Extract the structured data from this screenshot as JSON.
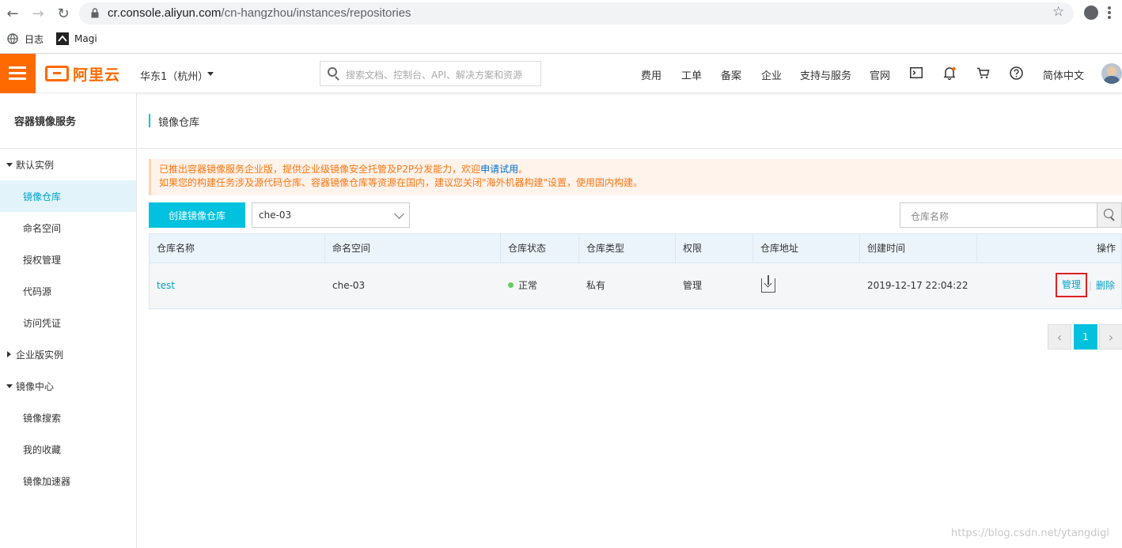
{
  "browser": {
    "url_host": "cr.console.aliyun.com",
    "url_path": "/cn-hangzhou/instances/repositories",
    "bookmarks": [
      {
        "label": "日志",
        "icon": "globe-icon"
      },
      {
        "label": "Magi",
        "icon": "magi-icon"
      }
    ]
  },
  "topbar": {
    "logo_text": "阿里云",
    "region": "华东1（杭州）",
    "search_placeholder": "搜索文档、控制台、API、解决方案和资源",
    "nav": [
      "费用",
      "工单",
      "备案",
      "企业",
      "支持与服务",
      "官网"
    ],
    "icons": [
      "terminal-icon",
      "bell-icon",
      "cart-icon",
      "help-icon"
    ],
    "language": "简体中文",
    "accent_color": "#ff6a00"
  },
  "sidebar": {
    "title": "容器镜像服务",
    "groups": [
      {
        "label": "默认实例",
        "expanded": true
      },
      {
        "label": "企业版实例",
        "expanded": false
      },
      {
        "label": "镜像中心",
        "expanded": true
      }
    ],
    "default_items": [
      "镜像仓库",
      "命名空间",
      "授权管理",
      "代码源",
      "访问凭证"
    ],
    "center_items": [
      "镜像搜索",
      "我的收藏",
      "镜像加速器"
    ],
    "active_item": "镜像仓库"
  },
  "main": {
    "page_title": "镜像仓库",
    "notice_line1_prefix": "已推出容器镜像服务企业版，提供企业级镜像安全托管及P2P分发能力，欢迎",
    "notice_line1_link": "申请试用",
    "notice_line1_suffix": "。",
    "notice_line2": "如果您的构建任务涉及源代码仓库、容器镜像仓库等资源在国内，建议您关闭\"海外机器构建\"设置，使用国内构建。",
    "create_button": "创建镜像仓库",
    "namespace_selected": "che-03",
    "search_placeholder": "仓库名称",
    "table": {
      "columns": [
        "仓库名称",
        "命名空间",
        "仓库状态",
        "仓库类型",
        "权限",
        "仓库地址",
        "创建时间",
        "操作"
      ],
      "rows": [
        {
          "name": "test",
          "namespace": "che-03",
          "status": "正常",
          "type": "私有",
          "permission": "管理",
          "address_icon": "download-icon",
          "created": "2019-12-17 22:04:22",
          "action_manage": "管理",
          "action_delete": "删除"
        }
      ]
    },
    "pagination": {
      "current": "1"
    }
  },
  "watermark": "https://blog.csdn.net/ytangdigl"
}
